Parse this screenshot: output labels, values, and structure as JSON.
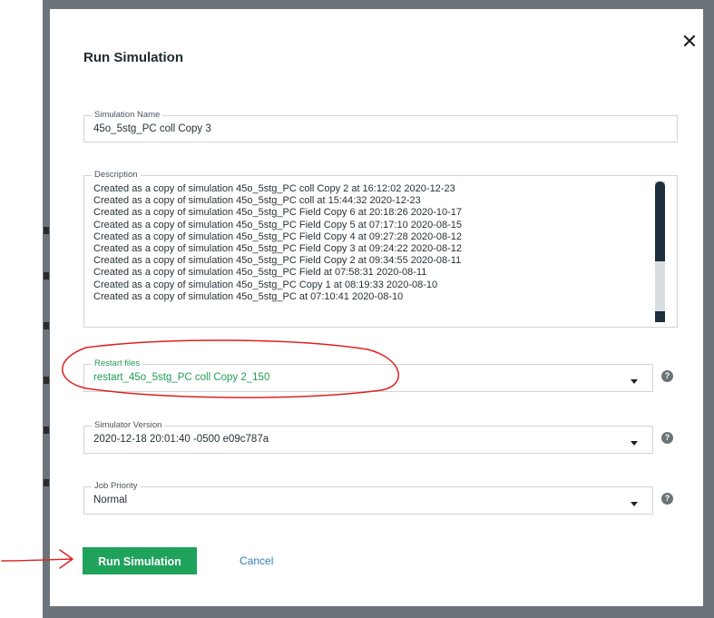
{
  "dialog": {
    "title": "Run Simulation",
    "close_icon": "close-icon"
  },
  "simulation_name": {
    "label": "Simulation Name",
    "value": "45o_5stg_PC coll Copy 3"
  },
  "description": {
    "label": "Description",
    "lines": [
      "Created as a copy of simulation 45o_5stg_PC coll Copy 2 at 16:12:02 2020-12-23",
      "Created as a copy of simulation 45o_5stg_PC coll at 15:44:32 2020-12-23",
      "Created as a copy of simulation 45o_5stg_PC Field Copy 6 at 20:18:26 2020-10-17",
      "Created as a copy of simulation 45o_5stg_PC Field Copy 5 at 07:17:10 2020-08-15",
      "Created as a copy of simulation 45o_5stg_PC Field Copy 4 at 09:27:28 2020-08-12",
      "Created as a copy of simulation 45o_5stg_PC Field Copy 3 at 09:24:22 2020-08-12",
      "Created as a copy of simulation 45o_5stg_PC Field Copy 2 at 09:34:55 2020-08-11",
      "Created as a copy of simulation 45o_5stg_PC Field at 07:58:31 2020-08-11",
      "Created as a copy of simulation 45o_5stg_PC Copy 1 at 08:19:33 2020-08-10",
      "Created as a copy of simulation 45o_5stg_PC at 07:10:41 2020-08-10"
    ]
  },
  "restart_files": {
    "label": "Restart files",
    "value": "restart_45o_5stg_PC coll Copy 2_150"
  },
  "simulator_version": {
    "label": "Simulator Version",
    "value": "2020-12-18 20:01:40 -0500 e09c787a"
  },
  "job_priority": {
    "label": "Job Priority",
    "value": "Normal"
  },
  "help_icon_glyph": "?",
  "close_glyph": "✕",
  "actions": {
    "run_label": "Run Simulation",
    "cancel_label": "Cancel"
  },
  "annotation_color": "#e02020",
  "accent_color": "#1fa35b"
}
